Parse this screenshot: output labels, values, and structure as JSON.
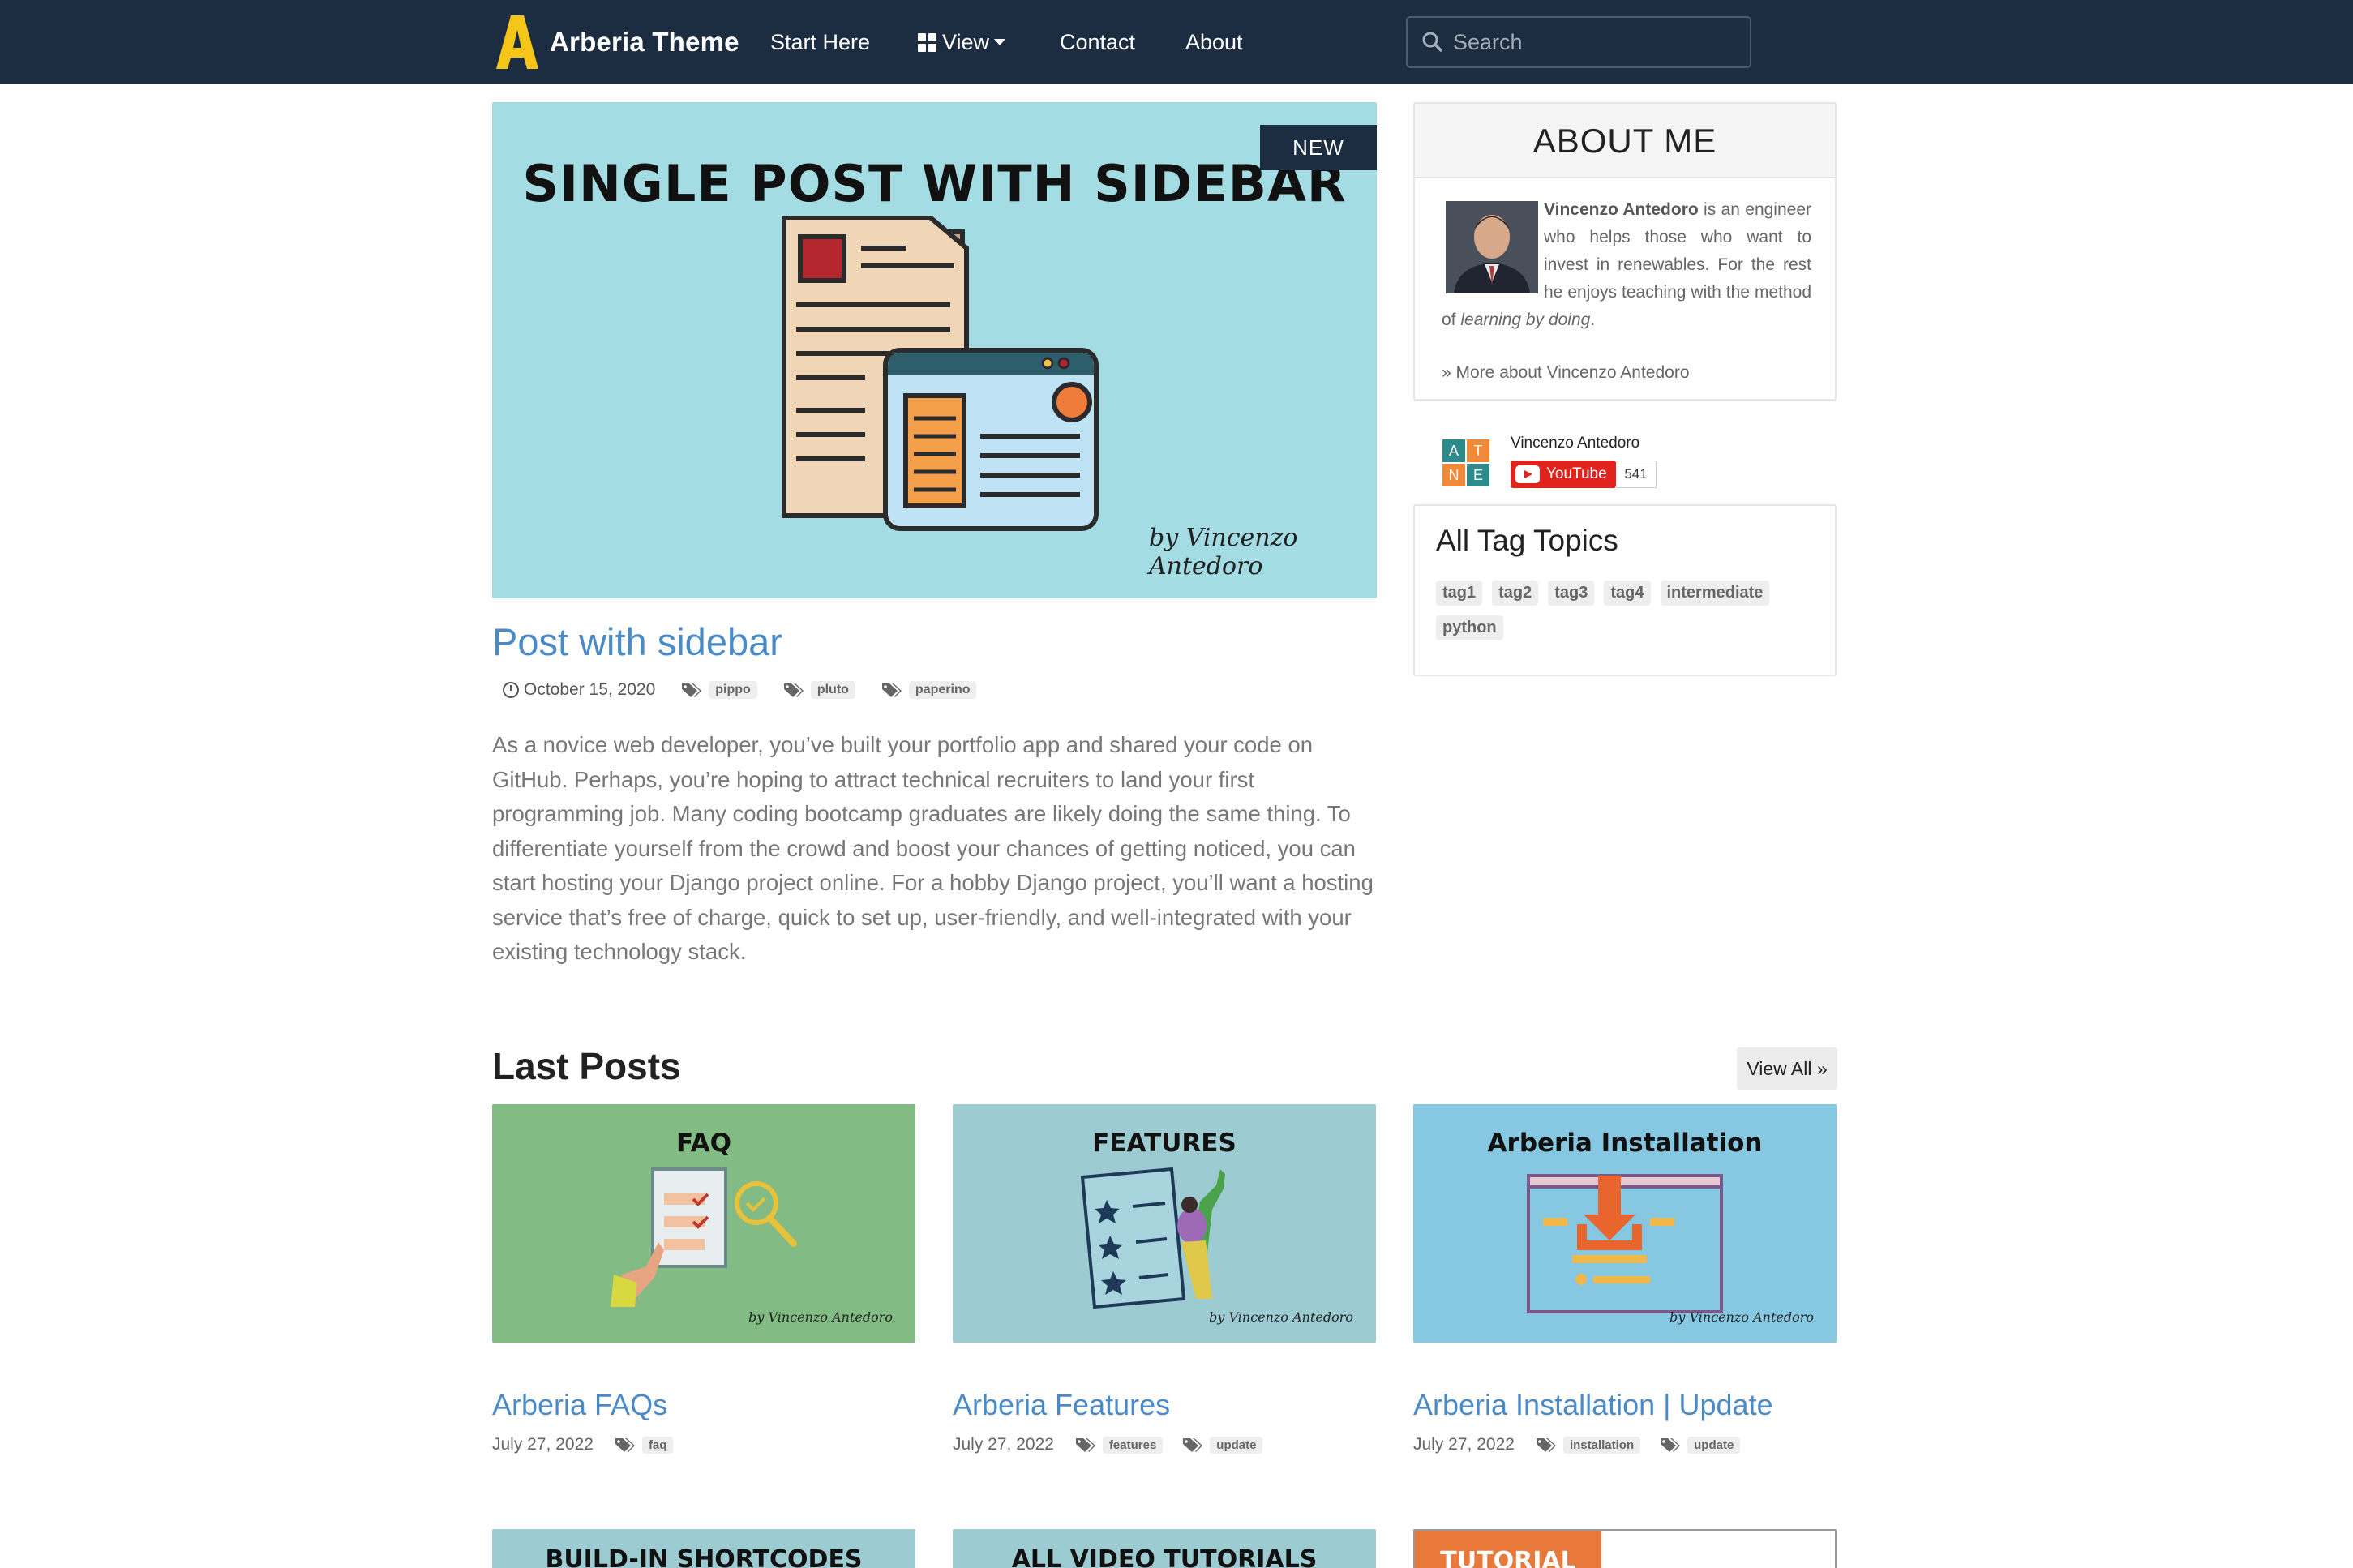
{
  "navbar": {
    "brand": "Arberia Theme",
    "items": [
      "Start Here",
      "View",
      "Contact",
      "About"
    ],
    "search_placeholder": "Search"
  },
  "featured": {
    "badge": "NEW",
    "image_title": "SINGLE POST WITH SIDEBAR",
    "image_signature": "by Vincenzo Antedoro",
    "title": "Post with sidebar",
    "date": "October 15, 2020",
    "tags": [
      "pippo",
      "pluto",
      "paperino"
    ],
    "excerpt": "As a novice web developer, you’ve built your portfolio app and shared your code on GitHub. Perhaps, you’re hoping to attract technical recruiters to land your first programming job. Many coding bootcamp graduates are likely doing the same thing. To differentiate yourself from the crowd and boost your chances of getting noticed, you can start hosting your Django project online. For a hobby Django project, you’ll want a hosting service that’s free of charge, quick to set up, user-friendly, and well-integrated with your existing technology stack."
  },
  "about": {
    "heading": "ABOUT ME",
    "name": "Vincenzo Antedoro",
    "bio_mid": " is an engineer who helps those who want to invest in renewables. For the rest he enjoys teaching with the method of ",
    "bio_em": "learning by doing",
    "bio_end": ".",
    "more_link": "» More about Vincenzo Antedoro"
  },
  "youtube": {
    "channel": "Vincenzo Antedoro",
    "button": "YouTube",
    "count": "541",
    "logo_letters": [
      "A",
      "T",
      "N",
      "E"
    ]
  },
  "tags_widget": {
    "title": "All Tag Topics",
    "tags": [
      "tag1",
      "tag2",
      "tag3",
      "tag4",
      "intermediate",
      "python"
    ]
  },
  "last_posts": {
    "heading": "Last Posts",
    "view_all": "View All »",
    "cards": [
      {
        "image_title": "FAQ",
        "title": "Arberia FAQs",
        "date": "July 27, 2022",
        "tags": [
          "faq"
        ]
      },
      {
        "image_title": "FEATURES",
        "title": "Arberia Features",
        "date": "July 27, 2022",
        "tags": [
          "features",
          "update"
        ]
      },
      {
        "image_title": "Arberia Installation",
        "title": "Arberia Installation | Update",
        "date": "July 27, 2022",
        "tags": [
          "installation",
          "update"
        ]
      }
    ],
    "card_signature": "by Vincenzo Antedoro",
    "bottom_cards": [
      "BUILD-IN SHORTCODES",
      "ALL VIDEO TUTORIALS",
      "TUTORIAL"
    ]
  },
  "colors": {
    "navbar": "#1c2d42",
    "link": "#4a8ac6",
    "hero_bg": "#a3dce3",
    "card_faq": "#82bb84",
    "card_features": "#9ccbd2",
    "card_install": "#86c7e2",
    "youtube_red": "#e1231d"
  },
  "icons": [
    "arberia-logo-icon",
    "grid-icon",
    "caret-down-icon",
    "search-icon",
    "clock-icon",
    "tags-icon",
    "youtube-play-icon"
  ]
}
